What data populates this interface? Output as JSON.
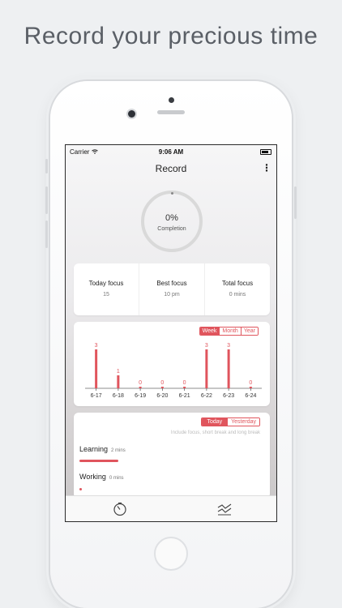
{
  "headline": "Record your precious time",
  "status": {
    "carrier": "Carrier",
    "time": "9:06 AM"
  },
  "nav": {
    "title": "Record",
    "more_icon": "more-vertical-icon"
  },
  "completion": {
    "percent_label": "0%",
    "label": "Completion",
    "value": 0
  },
  "stats": [
    {
      "label": "Today focus",
      "value": "15"
    },
    {
      "label": "Best focus",
      "value": "10 pm"
    },
    {
      "label": "Total focus",
      "value": "0 mins"
    }
  ],
  "range_tabs": {
    "options": [
      "Week",
      "Month",
      "Year"
    ],
    "selected": "Week"
  },
  "chart_data": {
    "type": "bar",
    "categories": [
      "6-17",
      "6-18",
      "6-19",
      "6-20",
      "6-21",
      "6-22",
      "6-23",
      "6-24"
    ],
    "values": [
      3,
      1,
      0,
      0,
      0,
      3,
      3,
      0
    ],
    "ylim": [
      0,
      3
    ],
    "color": "#e0555d"
  },
  "day_tabs": {
    "options": [
      "Today",
      "Yesterday"
    ],
    "selected": "Today"
  },
  "note": "Include focus, short break and long break",
  "tasks": [
    {
      "name": "Learning",
      "duration": "2 mins",
      "fraction": 1.0
    },
    {
      "name": "Working",
      "duration": "0 mins",
      "fraction": 0.0
    }
  ],
  "tabbar": {
    "icons": [
      "timer-icon",
      "statistics-icon"
    ]
  },
  "colors": {
    "accent": "#e0555d"
  }
}
